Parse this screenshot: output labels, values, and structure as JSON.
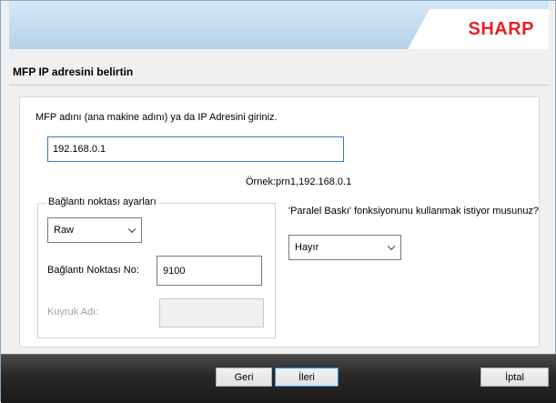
{
  "brand": {
    "logo_text": "SHARP",
    "accent_color": "#e8202a"
  },
  "page": {
    "title": "MFP IP adresini belirtin"
  },
  "address": {
    "instruction": "MFP adını (ana makine adını) ya da IP Adresini giriniz.",
    "value": "192.168.0.1",
    "example": "Örnek:prn1,192.168.0.1"
  },
  "port_settings": {
    "group_label": "Bağlantı noktası ayarları",
    "type_selected": "Raw",
    "port_label": "Bağlantı Noktası No:",
    "port_value": "9100",
    "queue_label": "Kuyruk Adı:",
    "queue_value": ""
  },
  "parallel": {
    "question": "'Paralel Baskı' fonksiyonunu kullanmak istiyor musunuz?",
    "selected": "Hayır"
  },
  "buttons": {
    "back": "Geri",
    "next": "İleri",
    "cancel": "İptal"
  },
  "icons": {
    "dropdown": "chevron-down-icon"
  }
}
